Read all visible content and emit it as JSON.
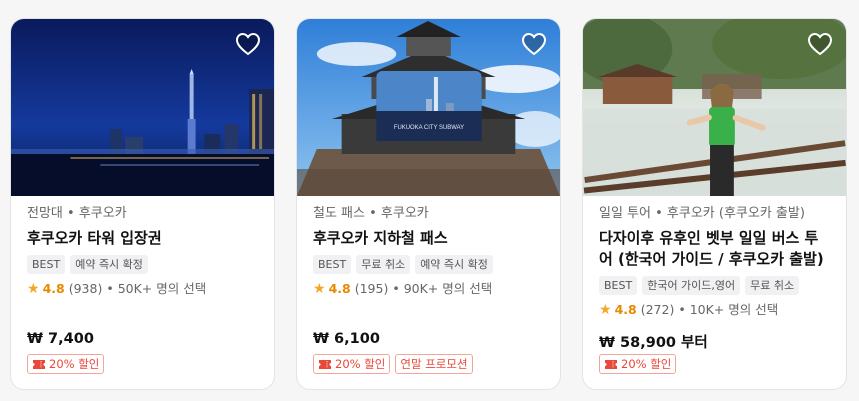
{
  "cards": [
    {
      "category": "전망대 • 후쿠오카",
      "title": "후쿠오카 타워 입장권",
      "tags": [
        "BEST",
        "예약 즉시 확정"
      ],
      "rating": "4.8",
      "reviews": "(938)",
      "selected": "• 50K+ 명의 선택",
      "price": "₩ 7,400",
      "badges": [
        {
          "type": "coupon",
          "label": "20% 할인"
        }
      ]
    },
    {
      "category": "철도 패스 • 후쿠오카",
      "title": "후쿠오카 지하철 패스",
      "tags": [
        "BEST",
        "무료 취소",
        "예약 즉시 확정"
      ],
      "rating": "4.8",
      "reviews": "(195)",
      "selected": "• 90K+ 명의 선택",
      "price": "₩ 6,100",
      "card_text": "FUKUOKA CITY SUBWAY",
      "badges": [
        {
          "type": "coupon",
          "label": "20% 할인"
        },
        {
          "type": "promo",
          "label": "연말 프로모션"
        }
      ]
    },
    {
      "category": "일일 투어 • 후쿠오카 (후쿠오카 출발)",
      "title": "다자이후 유후인 벳부 일일 버스 투어 (한국어 가이드 / 후쿠오카 출발)",
      "tags": [
        "BEST",
        "한국어 가이드,영어",
        "무료 취소"
      ],
      "rating": "4.8",
      "reviews": "(272)",
      "selected": "• 10K+ 명의 선택",
      "price": "₩ 58,900 부터",
      "badges": [
        {
          "type": "coupon",
          "label": "20% 할인"
        }
      ]
    }
  ],
  "colors": {
    "accent": "#e8483a",
    "star": "#f5a623"
  },
  "icons": {
    "wishlist": "heart-outline-icon",
    "coupon": "coupon-icon",
    "rating": "star-icon"
  }
}
